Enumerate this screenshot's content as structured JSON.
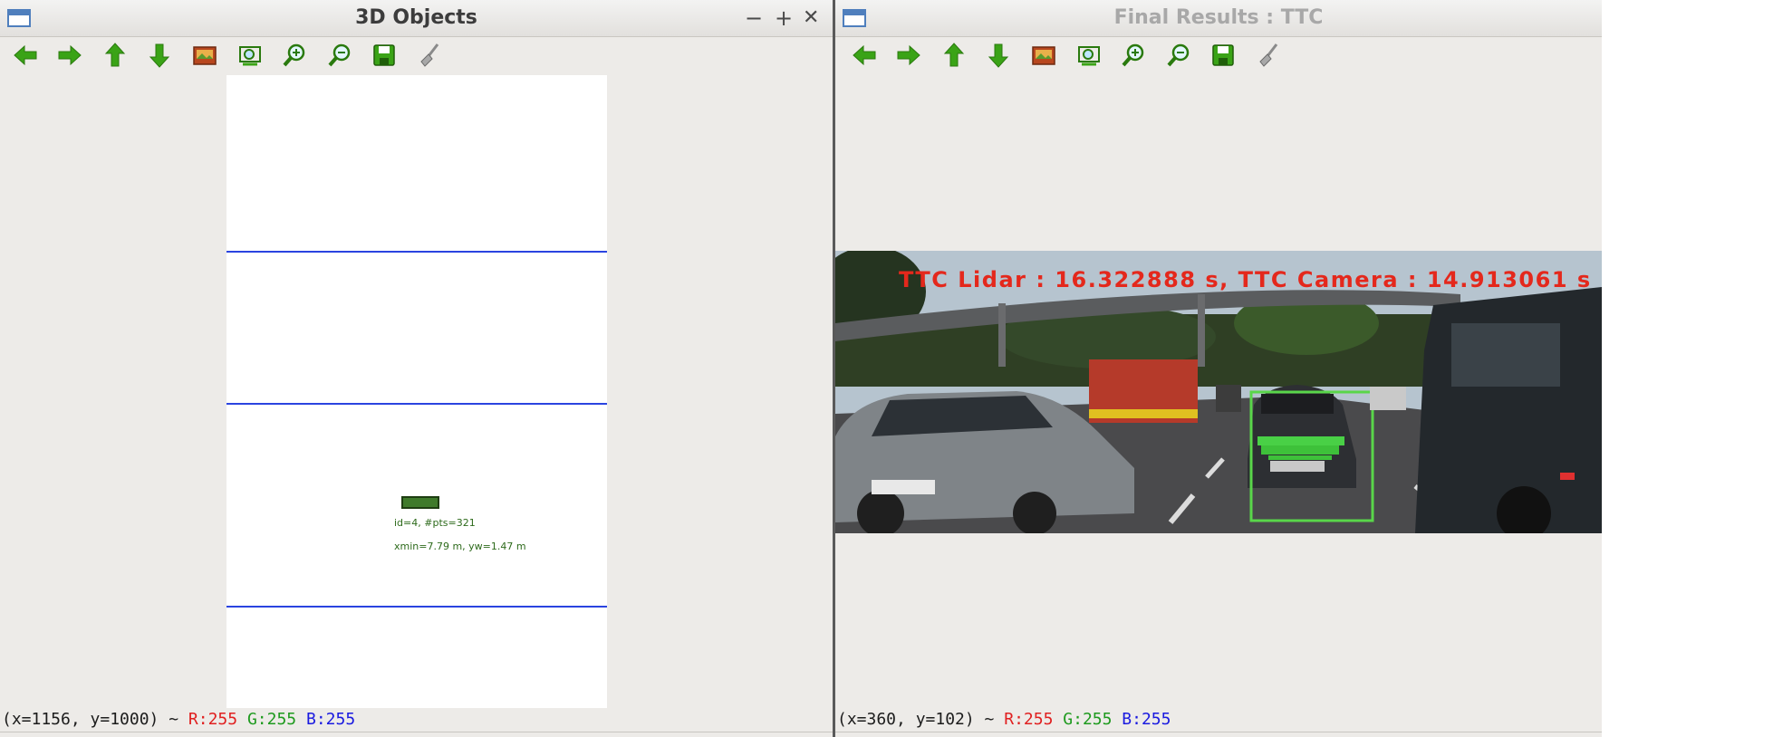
{
  "left_window": {
    "title": "3D Objects",
    "controls": {
      "minimize": "−",
      "maximize": "+",
      "close": "✕"
    },
    "object_label_1": "id=4, #pts=321",
    "object_label_2": "xmin=7.79 m, yw=1.47 m",
    "status": {
      "coords": "(x=1156, y=1000) ~",
      "r": "R:255",
      "g": "G:255",
      "b": "B:255"
    }
  },
  "right_window": {
    "title": "Final Results : TTC",
    "ttc_text": "TTC Lidar : 16.322888 s, TTC Camera : 14.913061 s",
    "status": {
      "coords": "(x=360, y=102) ~",
      "r": "R:255",
      "g": "G:255",
      "b": "B:255"
    }
  },
  "toolbar_icons": [
    "arrow-left-icon",
    "arrow-right-icon",
    "arrow-up-icon",
    "arrow-down-icon",
    "image-icon",
    "zoom-fit-icon",
    "zoom-in-icon",
    "zoom-out-icon",
    "save-icon",
    "clear-brush-icon"
  ],
  "colors": {
    "toolbar_green": "#3aa316",
    "ttc_red": "#e4281c",
    "plane_blue": "#2a44e0",
    "box_green": "#59d64a"
  }
}
